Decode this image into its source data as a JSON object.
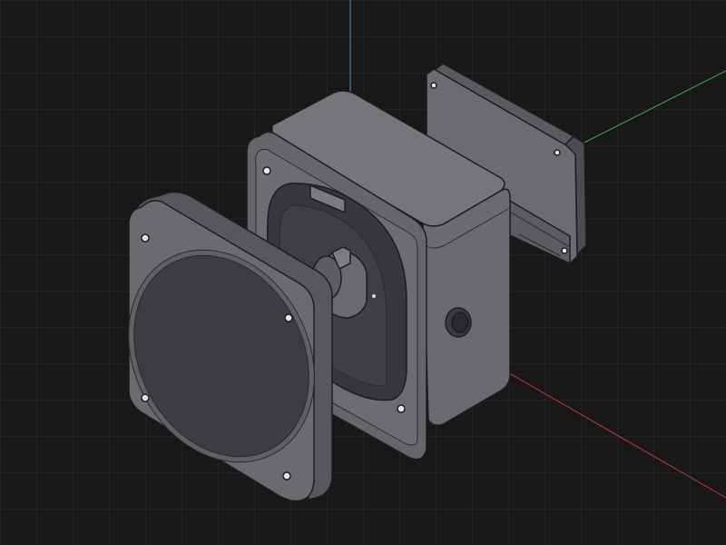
{
  "viewport": {
    "background_color": "#181818",
    "grid_color": "#2b2b2b",
    "show_grid": true
  },
  "axes": {
    "x": {
      "color": "#b83c3c"
    },
    "y": {
      "color": "#3fae4f"
    },
    "z": {
      "color": "#4f8fd8"
    }
  },
  "parts": {
    "body_color": "#67676d",
    "edge_color": "#1d1d20"
  }
}
